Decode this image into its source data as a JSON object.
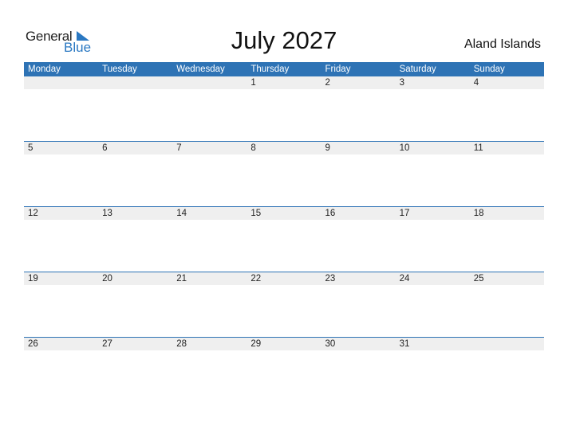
{
  "logo": {
    "general": "General",
    "blue": "Blue",
    "icon": "triangle-flag-icon"
  },
  "title": "July 2027",
  "country": "Aland Islands",
  "colors": {
    "accent": "#2e73b5",
    "row_shade": "#efefef"
  },
  "weekdays": [
    "Monday",
    "Tuesday",
    "Wednesday",
    "Thursday",
    "Friday",
    "Saturday",
    "Sunday"
  ],
  "weeks": [
    [
      "",
      "",
      "",
      "1",
      "2",
      "3",
      "4"
    ],
    [
      "5",
      "6",
      "7",
      "8",
      "9",
      "10",
      "11"
    ],
    [
      "12",
      "13",
      "14",
      "15",
      "16",
      "17",
      "18"
    ],
    [
      "19",
      "20",
      "21",
      "22",
      "23",
      "24",
      "25"
    ],
    [
      "26",
      "27",
      "28",
      "29",
      "30",
      "31",
      ""
    ]
  ]
}
